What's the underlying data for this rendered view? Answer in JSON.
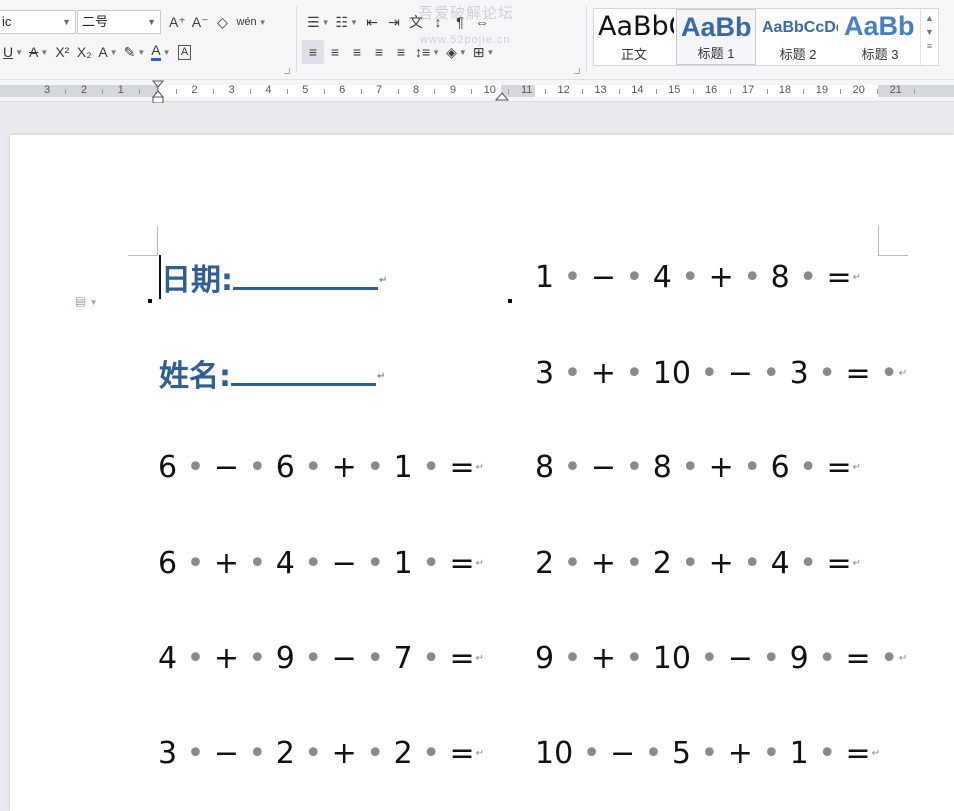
{
  "ribbon": {
    "font_name": "ic",
    "font_size": "二号",
    "watermark": "吾爱破解论坛",
    "watermark_url": "www.52pojie.cn",
    "styles": [
      {
        "preview": "AaBbCcDd",
        "label": "正文"
      },
      {
        "preview": "AaBb",
        "label": "标题 1"
      },
      {
        "preview": "AaBbCcDd",
        "label": "标题 2"
      },
      {
        "preview": "AaBb",
        "label": "标题 3"
      }
    ],
    "glyphs": {
      "grow_font": "A⁺",
      "shrink_font": "A⁻",
      "clear_format": "◇",
      "phonetic": "wén",
      "bullets": "☰",
      "numbering": "☷",
      "outdent": "⇤",
      "indent": "⇥",
      "chinese_layout": "文",
      "sort": "↕",
      "show_marks": "¶",
      "distributed": "⇔",
      "underline": "U",
      "strikethrough": "A",
      "superscript": "X²",
      "subscript": "X₂",
      "text_effect": "A",
      "highlight": "✎",
      "font_color": "A",
      "char_border": "A",
      "align_left": "≡",
      "align_center": "≡",
      "align_right": "≡",
      "justify": "≡",
      "distribute": "≡",
      "line_spacing": "↕≡",
      "shading": "◈",
      "borders": "⊞"
    }
  },
  "ruler": {
    "numbers": [
      "3",
      "2",
      "1",
      "1",
      "2",
      "3",
      "4",
      "5",
      "6",
      "7",
      "8",
      "9",
      "10",
      "11",
      "12",
      "13",
      "14",
      "15",
      "16",
      "17",
      "18",
      "19",
      "20",
      "21"
    ]
  },
  "document": {
    "header_left": [
      {
        "label": "日期:"
      },
      {
        "label": "姓名:"
      }
    ],
    "left_column": [
      "6 • − • 6 • + • 1 • =",
      "6 • + • 4 • − • 1 • =",
      "4 • + • 9 • − • 7 • =",
      "3 • − • 2 • + • 2 • ="
    ],
    "right_column": [
      "1 • − • 4 • + • 8 • =",
      "3 • + • 10 • − • 3 • = •",
      "8 • − • 8 • + • 6 • =",
      "2 • + • 2 • + • 4 • =",
      "9 • + • 10 • − • 9 • = •",
      "10 • − • 5 • + • 1 • ="
    ],
    "return_mark": "↵"
  }
}
